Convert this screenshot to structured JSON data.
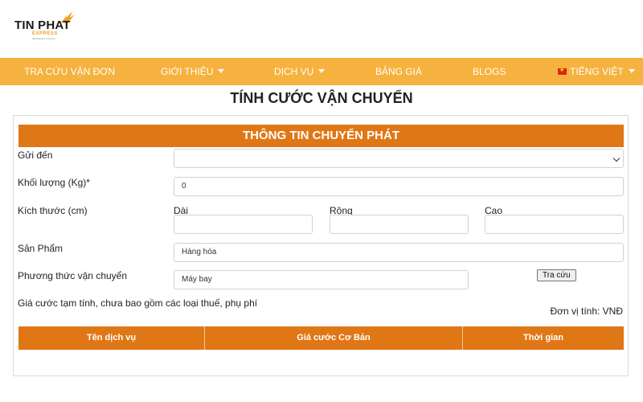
{
  "brand": {
    "name": "TIN PHAT",
    "sub": "EXPRESS",
    "tagline": "fast delivery & secure"
  },
  "nav": {
    "items": [
      {
        "label": "TRA CỨU VẬN ĐƠN"
      },
      {
        "label": "GIỚI THIỆU"
      },
      {
        "label": "DỊCH VỤ"
      },
      {
        "label": "BẢNG GIÁ"
      },
      {
        "label": "BLOGS"
      },
      {
        "label": "TIẾNG VIỆT"
      }
    ]
  },
  "page": {
    "title": "TÍNH CƯỚC VẬN CHUYỂN"
  },
  "form": {
    "section_title": "THÔNG TIN CHUYỂN PHÁT",
    "destination": {
      "label": "Gửi đến",
      "value": ""
    },
    "weight": {
      "label": "Khối lượng (Kg)*",
      "value": "0"
    },
    "dimensions": {
      "label": "Kích thước (cm)",
      "length_label": "Dài",
      "width_label": "Rộng",
      "height_label": "Cao",
      "length_value": "",
      "width_value": "",
      "height_value": ""
    },
    "product": {
      "label": "Sản Phẩm",
      "value": "Hàng hóa"
    },
    "shipping_method": {
      "label": "Phương thức vận chuyển",
      "value": "Máy bay"
    },
    "lookup_button": "Tra cứu",
    "note": "Giá cước tạm tính, chưa bao gồm các loại thuế, phụ phí",
    "unit": "Đơn vị tính: VNĐ"
  },
  "table": {
    "columns": [
      "Tên dịch vụ",
      "Giá cước Cơ Bản",
      "Thời gian"
    ]
  },
  "colors": {
    "nav_bg": "#f6b23e",
    "accent": "#e07716",
    "logo_accent": "#f0a020"
  }
}
